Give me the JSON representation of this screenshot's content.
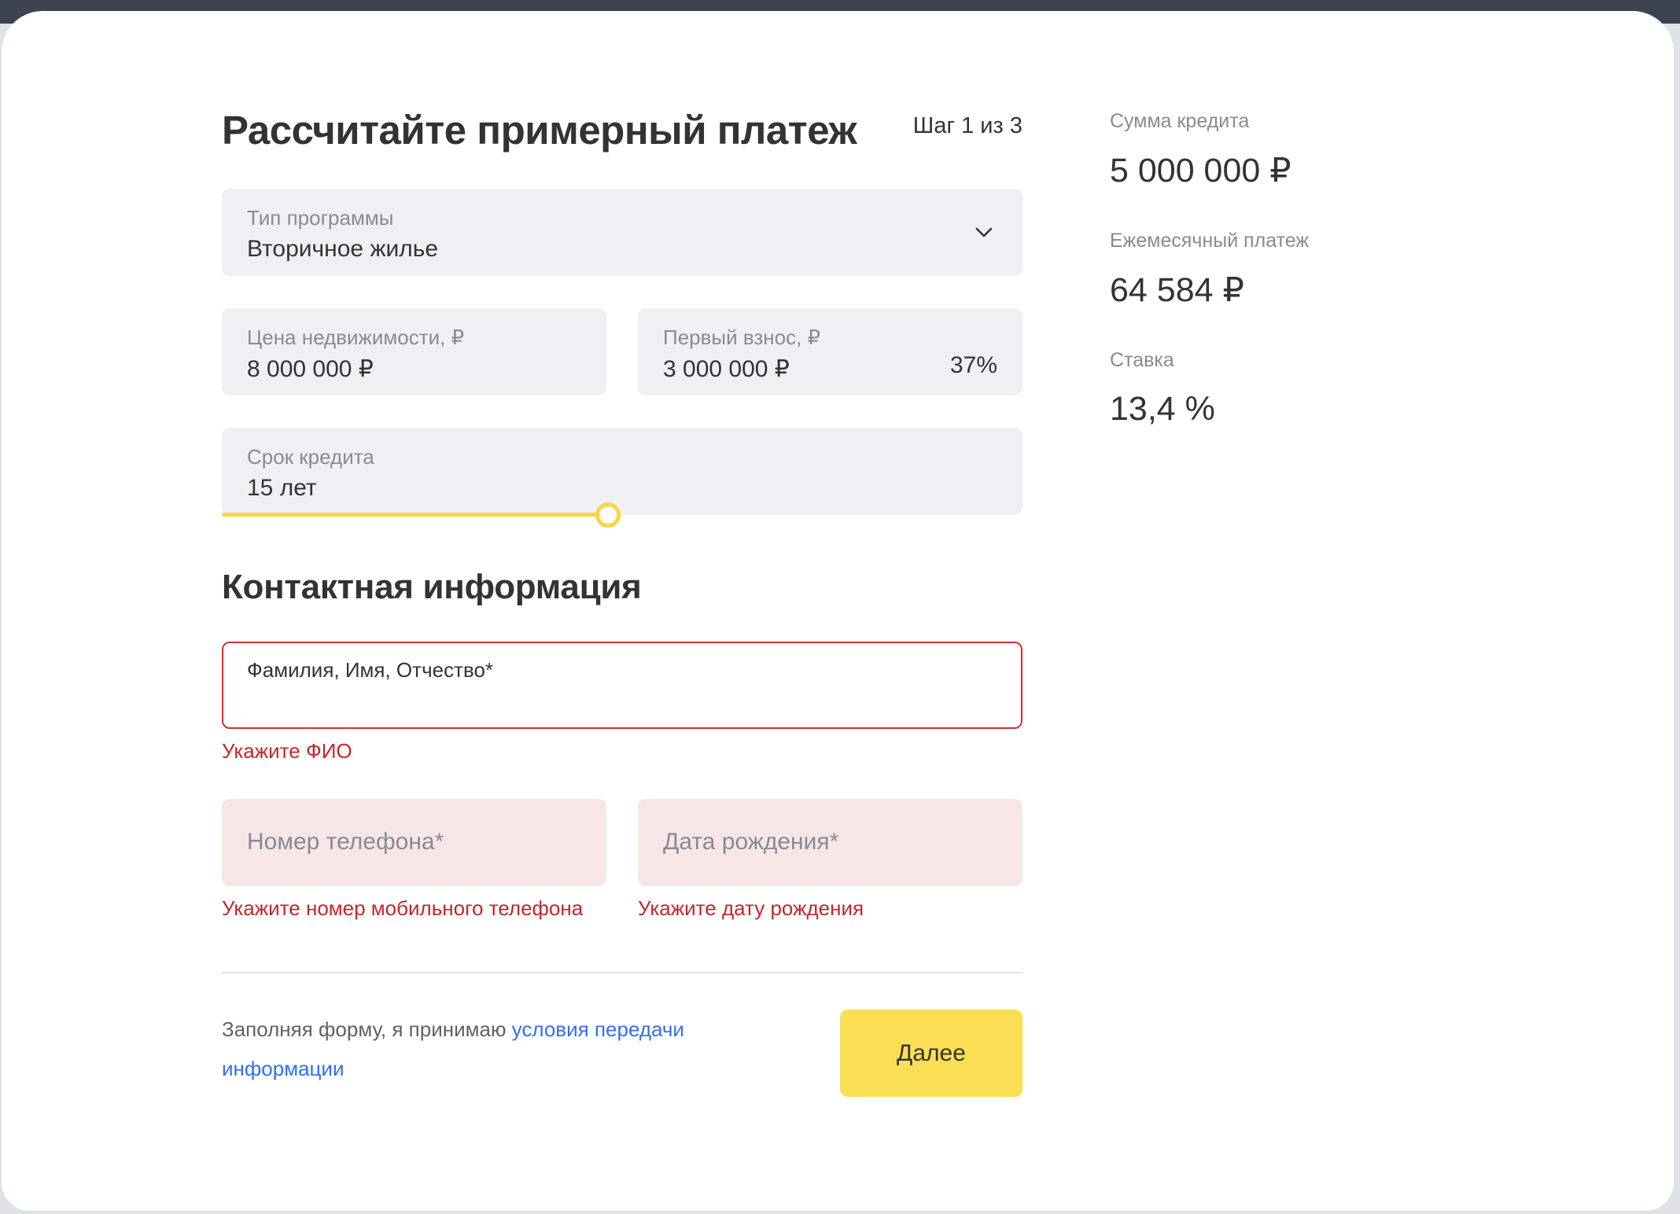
{
  "header": {
    "title": "Рассчитайте примерный платеж",
    "step": "Шаг 1 из 3"
  },
  "program": {
    "label": "Тип программы",
    "value": "Вторичное жилье",
    "icon": "chevron-down-icon"
  },
  "price": {
    "label": "Цена недвижимости, ₽",
    "value": "8 000 000 ₽"
  },
  "down_payment": {
    "label": "Первый взнос, ₽",
    "value": "3 000 000 ₽",
    "percent": "37%"
  },
  "term": {
    "label": "Срок кредита",
    "value": "15 лет"
  },
  "contacts": {
    "title": "Контактная информация",
    "fio_label": "Фамилия, Имя, Отчество*",
    "fio_error": "Укажите ФИО",
    "phone_placeholder": "Номер телефона*",
    "phone_error": "Укажите номер мобильного телефона",
    "birth_placeholder": "Дата рождения*",
    "birth_error": "Укажите дату рождения"
  },
  "footer": {
    "consent_text": "Заполняя форму, я принимаю ",
    "consent_link": "условия передачи информации",
    "next_button": "Далее"
  },
  "summary": {
    "loan_label": "Сумма кредита",
    "loan_value": "5 000 000 ₽",
    "monthly_label": "Ежемесячный платеж",
    "monthly_value": "64 584 ₽",
    "rate_label": "Ставка",
    "rate_value": "13,4 %"
  },
  "colors": {
    "accent_yellow": "#fadf55",
    "error_red": "#c2272d",
    "link_blue": "#336fee",
    "field_bg": "#eef0f4",
    "error_field_bg": "#f8e6e6"
  }
}
